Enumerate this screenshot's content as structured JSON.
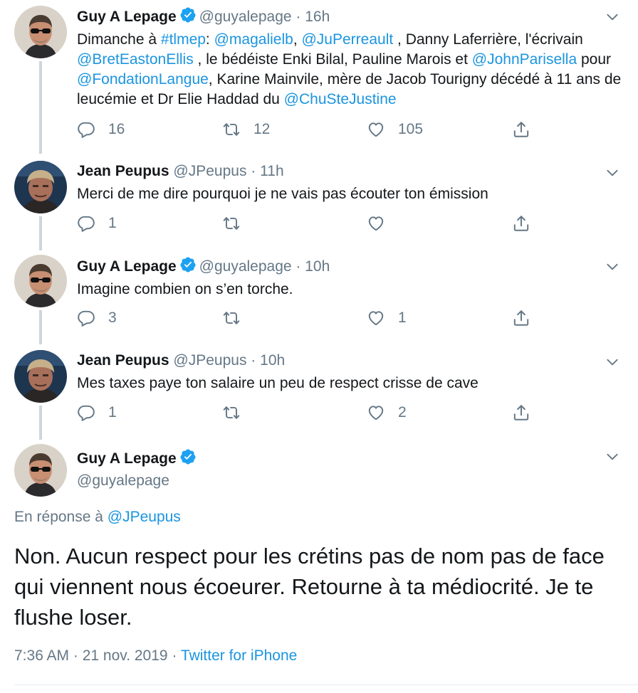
{
  "tweets": [
    {
      "name": "Guy A Lepage",
      "handle": "@guyalepage",
      "time": "16h",
      "text_parts": [
        "Dimanche à ",
        "#tlmep",
        ": ",
        "@magalielb",
        ", ",
        "@JuPerreault",
        " , Danny Laferrière, l'écrivain ",
        "@BretEastonEllis",
        " , le bédéiste Enki Bilal, Pauline Marois et ",
        "@JohnParisella",
        " pour ",
        "@FondationLangue",
        ", Karine Mainvile, mère de Jacob Tourigny décédé à 11 ans de leucémie et Dr Elie Haddad du ",
        "@ChuSteJustine"
      ],
      "replies": "16",
      "retweets": "12",
      "likes": "105"
    },
    {
      "name": "Jean Peupus",
      "handle": "@JPeupus",
      "time": "11h",
      "text": "Merci de me dire pourquoi je ne vais pas écouter ton émission",
      "replies": "1",
      "retweets": "",
      "likes": ""
    },
    {
      "name": "Guy A Lepage",
      "handle": "@guyalepage",
      "time": "10h",
      "text": "Imagine combien on s’en torche.",
      "replies": "3",
      "retweets": "",
      "likes": "1"
    },
    {
      "name": "Jean Peupus",
      "handle": "@JPeupus",
      "time": "10h",
      "text": "Mes taxes paye ton salaire un peu de respect crisse de cave",
      "replies": "1",
      "retweets": "",
      "likes": "2"
    }
  ],
  "main": {
    "name": "Guy A Lepage",
    "handle": "@guyalepage",
    "reply_prefix": "En réponse à ",
    "reply_to": "@JPeupus",
    "text": "Non. Aucun respect pour les crétins pas de nom pas de face qui viennent nous écoeurer. Retourne à ta médiocrité. Je te flushe loser.",
    "timestamp": "7:36 AM · 21 nov. 2019",
    "separator": "·",
    "source": "Twitter for iPhone"
  },
  "colors": {
    "accent": "#1b95e0",
    "muted": "#657786",
    "thread_line": "#ccd6dd"
  },
  "icons": [
    "verified-badge-icon",
    "chevron-down-icon",
    "reply-icon",
    "retweet-icon",
    "like-icon",
    "share-icon"
  ]
}
